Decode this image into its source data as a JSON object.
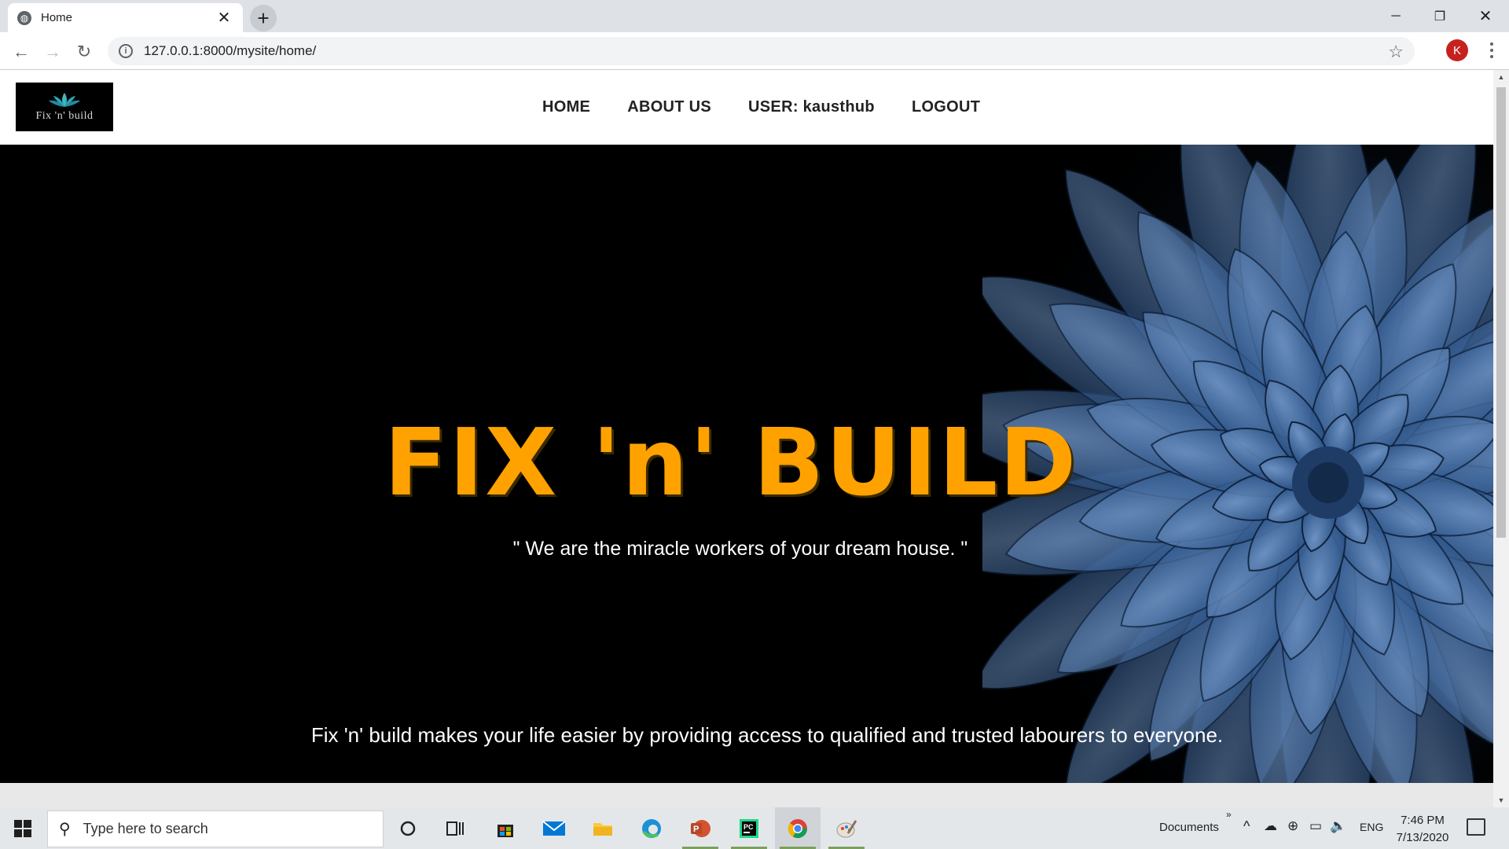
{
  "browser": {
    "tab_title": "Home",
    "url": "127.0.0.1:8000/mysite/home/",
    "profile_initial": "K"
  },
  "site": {
    "logo_text": "Fix 'n' build",
    "nav": {
      "home": "HOME",
      "about": "ABOUT US",
      "user": "USER: kausthub",
      "logout": "LOGOUT"
    },
    "hero": {
      "title": "FIX 'n' BUILD",
      "quote": "\" We are the miracle workers of your dream house. \"",
      "description": "Fix 'n' build makes your life easier by providing access to qualified and trusted labourers to everyone."
    },
    "colors": {
      "accent": "#ffa200",
      "hero_bg": "#000000",
      "flower": "#2f5a8f"
    }
  },
  "taskbar": {
    "search_placeholder": "Type here to search",
    "documents_label": "Documents",
    "language": "ENG",
    "time": "7:46 PM",
    "date": "7/13/2020",
    "icons": [
      "cortana-icon",
      "task-view-icon",
      "store-icon",
      "mail-icon",
      "file-explorer-icon",
      "edge-icon",
      "powerpoint-icon",
      "pycharm-icon",
      "chrome-icon",
      "paint-icon"
    ]
  }
}
